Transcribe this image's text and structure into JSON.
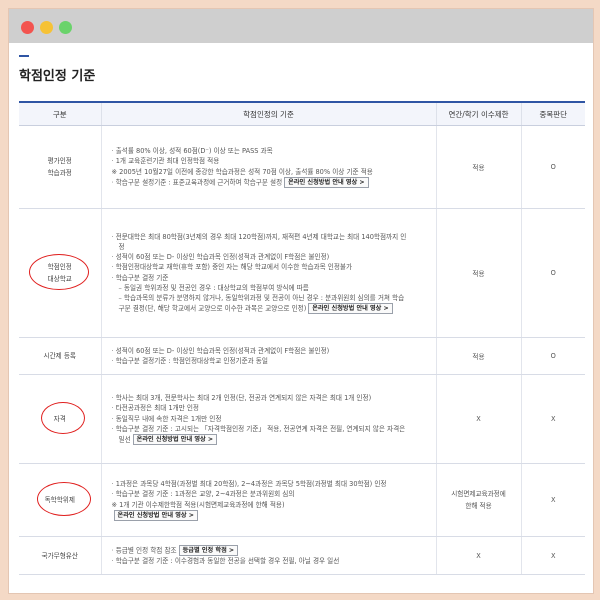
{
  "page_title": "학점인정 기준",
  "table": {
    "headers": [
      "구분",
      "학점인정의 기준",
      "연간/학기 이수제한",
      "중복판단"
    ],
    "rows": [
      {
        "category": [
          "평가인정",
          "학습과정"
        ],
        "criteria": [
          {
            "text": "출석률 80% 이상, 성적 60점(D⁻) 이상 또는 PASS 과목",
            "bullet": "·"
          },
          {
            "text": "1개 교육훈련기관 최대 인정학점 적용",
            "bullet": "·"
          },
          {
            "text": "※ 2005년 10월27일 이전에 종강한 학습과정은 성적 70점 이상, 출석률 80% 이상 기준 적용",
            "bullet": ""
          },
          {
            "text": "학습구분 설정기준 : 표준교육과정에 근거하여 학습구분 설정",
            "bullet": "·",
            "button": "온라인 신청방법 안내 영상 >"
          }
        ],
        "limit": "적용",
        "duplicate": "O"
      },
      {
        "category": [
          "학점인정",
          "대상학교"
        ],
        "criteria": [
          {
            "text": "전문대학은 최대 80학점(3년제의 경우 최대 120학점)까지, 재적편 4년제 대학교는 최대 140학점까지 인",
            "bullet": "·"
          },
          {
            "text": "정",
            "bullet": "",
            "indent": true
          },
          {
            "text": "성적이 60점 또는 D- 이상인 학습과목 인정(성적과 관계없이 F학점은 불인정)",
            "bullet": "·"
          },
          {
            "text": "학점인정대상학교 재학(휴학 포함) 중인 자는 해당 학교에서 이수한 학습과목 인정불가",
            "bullet": "·"
          },
          {
            "text": "학습구분 결정 기준",
            "bullet": "·"
          },
          {
            "text": "동일권 학위과정 및 전공인 경우 : 대상학교의 학점부여 방식에 따름",
            "bullet": "–",
            "indent": true
          },
          {
            "text": "학습과목의 분류가 분명하지 않거나, 동일학위과정 및 전공이 아닌 경우 : 분과위원회 심의를 거쳐 학습",
            "bullet": "–",
            "indent": true
          },
          {
            "text": "구분 결정(단, 해당 학교에서 교양으로 이수한 과목은 교양으로 인정)",
            "bullet": "",
            "indent": true,
            "button": "온라인 신청방법 안내 영상 >"
          }
        ],
        "limit": "적용",
        "duplicate": "O"
      },
      {
        "category": [
          "시간제 등록"
        ],
        "criteria": [
          {
            "text": "성적이 60점 또는 D- 이상인 학습과목 인정(성적과 관계없이 F학점은 불인정)",
            "bullet": "·"
          },
          {
            "text": "학습구분 결정기준 : 학점인정대상학교 인정기준과 동일",
            "bullet": "·"
          }
        ],
        "limit": "적용",
        "duplicate": "O"
      },
      {
        "category": [
          "자격"
        ],
        "criteria": [
          {
            "text": "학사는 최대 3개, 전문학사는 최대 2개 인정(단, 전공과 연계되지 않은 자격은 최대 1개 인정)",
            "bullet": "·"
          },
          {
            "text": "타전공과정은 최대 1개만 인정",
            "bullet": "·"
          },
          {
            "text": "동일직무 내에 속한 자격은 1개만 인정",
            "bullet": "·"
          },
          {
            "text": "학습구분 결정 기준 : 고시되는 「자격학점인정 기준」 적용, 전공연계 자격은 전필, 연계되지 않은 자격은",
            "bullet": "·"
          },
          {
            "text": "일선",
            "bullet": "",
            "indent": true,
            "button": "온라인 신청방법 안내 영상 >"
          }
        ],
        "limit": "X",
        "duplicate": "X"
      },
      {
        "category": [
          "독학학위제"
        ],
        "criteria": [
          {
            "text": "1과정은 과목당 4학점(과정별 최대 20학점), 2~4과정은 과목당 5학점(과정별 최대 30학점) 인정",
            "bullet": "·"
          },
          {
            "text": "학습구분 결정 기준 : 1과정은 교양, 2~4과정은 분과위원회 심의",
            "bullet": "·"
          },
          {
            "text": "※ 1개 기관 이수제한학점 적용(시험면제교육과정에 한해 적용)",
            "bullet": ""
          },
          {
            "text": "",
            "bullet": "",
            "button": "온라인 신청방법 안내 영상 >"
          }
        ],
        "limit": "시험면제교육과정에 한해 적용",
        "limit_lines": [
          "시험면제교육과정에",
          "한해 적용"
        ],
        "duplicate": "X"
      },
      {
        "category": [
          "국가무형유산"
        ],
        "criteria": [
          {
            "text": "등급별 인정 학점 참조",
            "bullet": "·",
            "button": "등급별 인정 학점 >"
          },
          {
            "text": "학습구분 결정 기준 : 이수경험과 동일한 전공을 선택할 경우 전필, 아닐 경우 일선",
            "bullet": "·"
          }
        ],
        "limit": "X",
        "duplicate": "X"
      }
    ]
  }
}
